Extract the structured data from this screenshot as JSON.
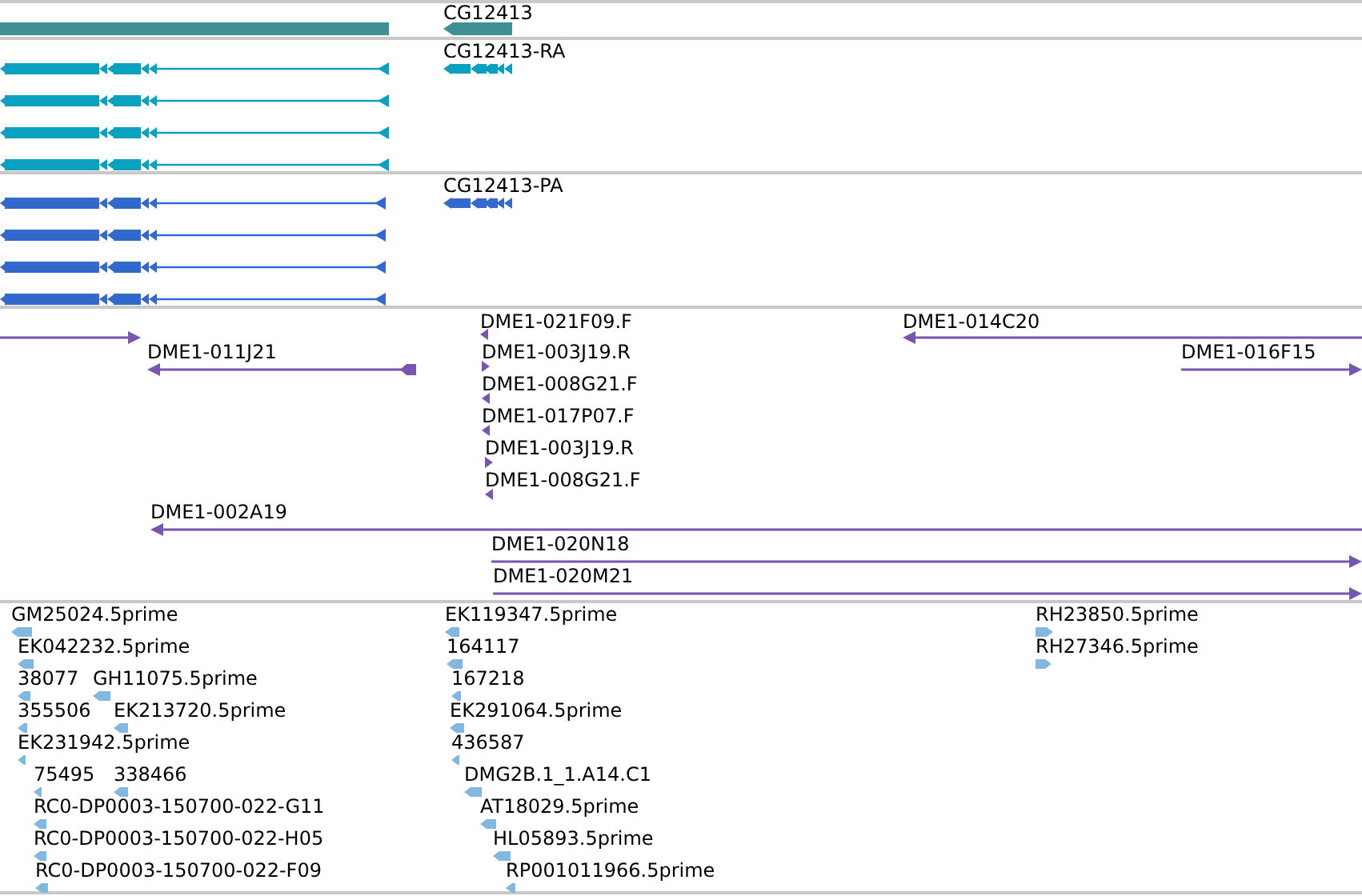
{
  "tracks": [
    {
      "kind": "gene",
      "features": [
        {
          "clipped": true
        },
        {
          "label": "CG12413",
          "reverse": true
        }
      ]
    },
    {
      "kind": "transcript_ra",
      "features": [
        {
          "reverse": true
        },
        {
          "reverse": true
        },
        {
          "reverse": true
        },
        {
          "reverse": true
        },
        {
          "label": "CG12413-RA",
          "reverse": true
        }
      ]
    },
    {
      "kind": "transcript_pa",
      "features": [
        {
          "reverse": true
        },
        {
          "reverse": true
        },
        {
          "reverse": true
        },
        {
          "reverse": true
        },
        {
          "label": "CG12413-PA",
          "reverse": true
        }
      ]
    },
    {
      "kind": "clone",
      "features": [
        {
          "reverse": false
        },
        {
          "label": "DME1-011J21",
          "reverse": true
        },
        {
          "label": "DME1-021F09.F",
          "reverse": true
        },
        {
          "label": "DME1-003J19.R",
          "reverse": false
        },
        {
          "label": "DME1-008G21.F",
          "reverse": true
        },
        {
          "label": "DME1-017P07.F",
          "reverse": true
        },
        {
          "label": "DME1-003J19.R",
          "reverse": false
        },
        {
          "label": "DME1-008G21.F",
          "reverse": true
        },
        {
          "label": "DME1-014C20",
          "reverse": true
        },
        {
          "label": "DME1-016F15",
          "reverse": false
        },
        {
          "label": "DME1-002A19",
          "reverse": true
        },
        {
          "label": "DME1-020N18",
          "reverse": false
        },
        {
          "label": "DME1-020M21",
          "reverse": false
        }
      ]
    },
    {
      "kind": "est",
      "features": [
        {
          "label": "GM25024.5prime",
          "reverse": true
        },
        {
          "label": "EK042232.5prime",
          "reverse": true
        },
        {
          "label": "38077",
          "reverse": true
        },
        {
          "label": "GH11075.5prime",
          "reverse": true
        },
        {
          "label": "355506",
          "reverse": true
        },
        {
          "label": "EK213720.5prime",
          "reverse": true
        },
        {
          "label": "EK231942.5prime",
          "reverse": true
        },
        {
          "label": "75495",
          "reverse": true
        },
        {
          "label": "338466",
          "reverse": true
        },
        {
          "label": "RC0-DP0003-150700-022-G11",
          "reverse": true
        },
        {
          "label": "RC0-DP0003-150700-022-H05",
          "reverse": true
        },
        {
          "label": "RC0-DP0003-150700-022-F09",
          "reverse": true
        },
        {
          "label": "EK119347.5prime",
          "reverse": true
        },
        {
          "label": "164117",
          "reverse": true
        },
        {
          "label": "167218",
          "reverse": true
        },
        {
          "label": "EK291064.5prime",
          "reverse": true
        },
        {
          "label": "436587",
          "reverse": true
        },
        {
          "label": "DMG2B.1_1.A14.C1",
          "reverse": true
        },
        {
          "label": "AT18029.5prime",
          "reverse": true
        },
        {
          "label": "HL05893.5prime",
          "reverse": true
        },
        {
          "label": "RP001011966.5prime",
          "reverse": true
        },
        {
          "label": "RH23850.5prime",
          "reverse": false
        },
        {
          "label": "RH27346.5prime",
          "reverse": false
        }
      ]
    }
  ]
}
